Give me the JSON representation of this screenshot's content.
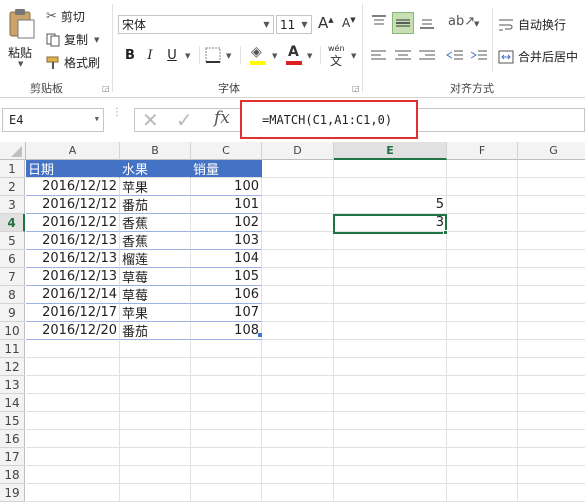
{
  "clipboard": {
    "paste": "粘贴",
    "cut": "剪切",
    "copy": "复制",
    "format_painter": "格式刷",
    "group_label": "剪贴板"
  },
  "font": {
    "name": "宋体",
    "size": "11",
    "bold": "B",
    "italic": "I",
    "underline": "U",
    "phonetic": "wén",
    "group_label": "字体"
  },
  "alignment": {
    "wrap_text": "自动换行",
    "merge_center": "合并后居中",
    "group_label": "对齐方式"
  },
  "formula_bar": {
    "name_box": "E4",
    "fx": "fx",
    "formula": "=MATCH(C1,A1:C1,0)"
  },
  "columns": [
    "A",
    "B",
    "C",
    "D",
    "E",
    "F",
    "G"
  ],
  "rows": [
    "1",
    "2",
    "3",
    "4",
    "5",
    "6",
    "7",
    "8",
    "9",
    "10",
    "11",
    "12",
    "13",
    "14",
    "15",
    "16",
    "17",
    "18",
    "19"
  ],
  "table": {
    "headers": [
      "日期",
      "水果",
      "销量"
    ],
    "rows": [
      [
        "2016/12/12",
        "苹果",
        "100"
      ],
      [
        "2016/12/12",
        "番茄",
        "101"
      ],
      [
        "2016/12/12",
        "香蕉",
        "102"
      ],
      [
        "2016/12/13",
        "香蕉",
        "103"
      ],
      [
        "2016/12/13",
        "榴莲",
        "104"
      ],
      [
        "2016/12/13",
        "草莓",
        "105"
      ],
      [
        "2016/12/14",
        "草莓",
        "106"
      ],
      [
        "2016/12/17",
        "苹果",
        "107"
      ],
      [
        "2016/12/20",
        "番茄",
        "108"
      ]
    ]
  },
  "col_e": {
    "e3": "5",
    "e4": "3"
  },
  "colors": {
    "accent": "#217346",
    "table_header": "#4472c4",
    "highlight": "#e03030"
  }
}
